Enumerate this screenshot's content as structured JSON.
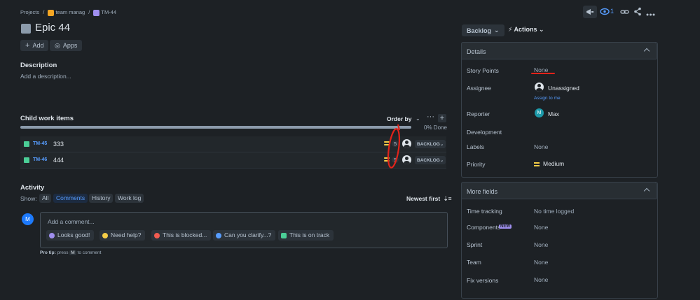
{
  "breadcrumb": {
    "projects": "Projects",
    "project": "team manag",
    "issue": "TM-44",
    "sep": "/"
  },
  "header": {
    "title": "Epic 44",
    "add_label": "Add",
    "apps_label": "Apps",
    "watchers_count": "1"
  },
  "description": {
    "heading": "Description",
    "placeholder": "Add a description..."
  },
  "child_items": {
    "heading": "Child work items",
    "order_by": "Order by",
    "progress_text": "0% Done",
    "progress_fraction": 0,
    "items": [
      {
        "key": "TM-45",
        "title": "333",
        "points": "5",
        "status": "BACKLOG"
      },
      {
        "key": "TM-46",
        "title": "444",
        "points": "5",
        "status": "BACKLOG"
      }
    ]
  },
  "activity": {
    "heading": "Activity",
    "show_label": "Show:",
    "tabs": [
      "All",
      "Comments",
      "History",
      "Work log"
    ],
    "active_tab": "Comments",
    "sort_label": "Newest first",
    "comment_placeholder": "Add a comment...",
    "avatar_initial": "M",
    "quick_replies": [
      "Looks good!",
      "Need help?",
      "This is blocked...",
      "Can you clarify...?",
      "This is on track"
    ],
    "pro_tip_label": "Pro tip:",
    "pro_tip_press": "press",
    "pro_tip_key": "M",
    "pro_tip_tail": "to comment"
  },
  "toolbar": {
    "status": "Backlog",
    "actions": "Actions"
  },
  "details": {
    "heading": "Details",
    "fields": {
      "story_points": {
        "label": "Story Points",
        "value": "None"
      },
      "assignee": {
        "label": "Assignee",
        "value": "Unassigned",
        "assign_link": "Assign to me"
      },
      "reporter": {
        "label": "Reporter",
        "value": "Max",
        "initial": "M"
      },
      "development": {
        "label": "Development"
      },
      "labels": {
        "label": "Labels",
        "value": "None"
      },
      "priority": {
        "label": "Priority",
        "value": "Medium"
      }
    }
  },
  "more_fields": {
    "heading": "More fields",
    "time_tracking": {
      "label": "Time tracking",
      "value": "No time logged"
    },
    "components": {
      "label": "Components",
      "badge": "NEW",
      "value": "None"
    },
    "sprint": {
      "label": "Sprint",
      "value": "None"
    },
    "team": {
      "label": "Team",
      "value": "None"
    },
    "fix_versions": {
      "label": "Fix versions",
      "value": "None"
    }
  },
  "colors": {
    "background": "#1d2125",
    "accent": "#579dff",
    "annotation": "#e2231a",
    "priority_medium": "#f5cd47",
    "story": "#4bce97",
    "epic": "#9f8fef"
  }
}
